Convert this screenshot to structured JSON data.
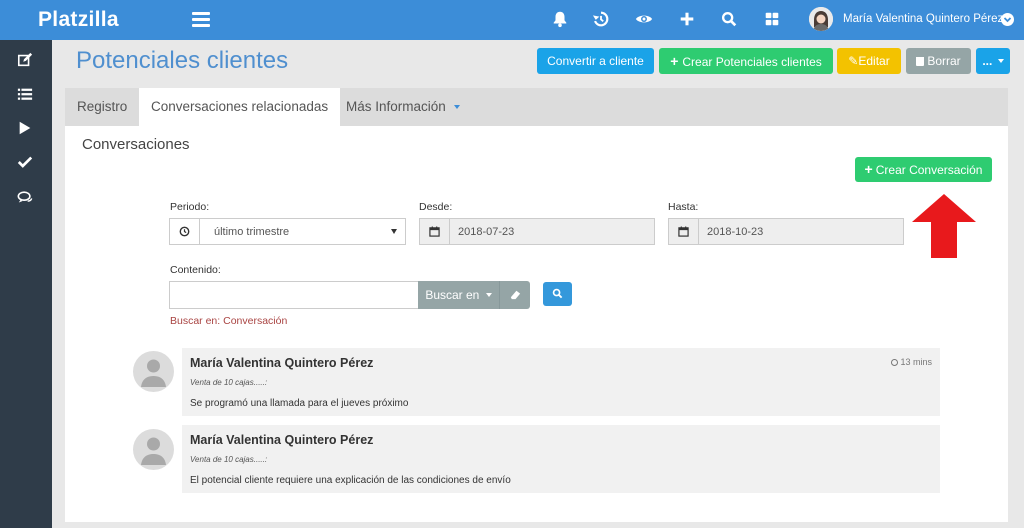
{
  "app": {
    "brand": "Platzilla"
  },
  "header": {
    "user_name": "María Valentina Quintero Pérez",
    "icons": [
      "bell-icon",
      "history-icon",
      "eye-icon",
      "plus-icon",
      "search-icon",
      "grid-icon"
    ]
  },
  "sidebar": {
    "icons": [
      "edit-icon",
      "list-icon",
      "play-icon",
      "check-icon",
      "comments-icon"
    ]
  },
  "page": {
    "title": "Potenciales clientes",
    "actions": {
      "convert": "Convertir a cliente",
      "create": "Crear Potenciales clientes",
      "edit": "Editar",
      "delete": "Borrar",
      "more": "..."
    }
  },
  "tabs": [
    {
      "label": "Registro"
    },
    {
      "label": "Conversaciones relacionadas"
    },
    {
      "label": "Más Información"
    }
  ],
  "conversations": {
    "section_title": "Conversaciones",
    "new_button": "Crear Conversación",
    "filters": {
      "period_label": "Periodo:",
      "period_value": "último trimestre",
      "from_label": "Desde:",
      "from_value": "2018-07-23",
      "to_label": "Hasta:",
      "to_value": "2018-10-23",
      "content_label": "Contenido:",
      "content_value": "",
      "search_in_button": "Buscar en",
      "search_hint": "Buscar en: Conversación"
    },
    "items": [
      {
        "author": "María Valentina Quintero Pérez",
        "subject": "Venta de 10 cajas.....:",
        "body": "Se programó una llamada para el jueves próximo",
        "time": "13 mins"
      },
      {
        "author": "María Valentina Quintero Pérez",
        "subject": "Venta de 10 cajas.....:",
        "body": "El potencial cliente requiere una explicación de las condiciones de envío",
        "time": ""
      }
    ]
  },
  "colors": {
    "header": "#3c8dd8",
    "sidebar": "#2f3c49",
    "primary": "#1aa3e8",
    "success": "#2ecc71",
    "warning": "#f3c200",
    "muted": "#95a5a6",
    "annotation": "#e8191c"
  }
}
